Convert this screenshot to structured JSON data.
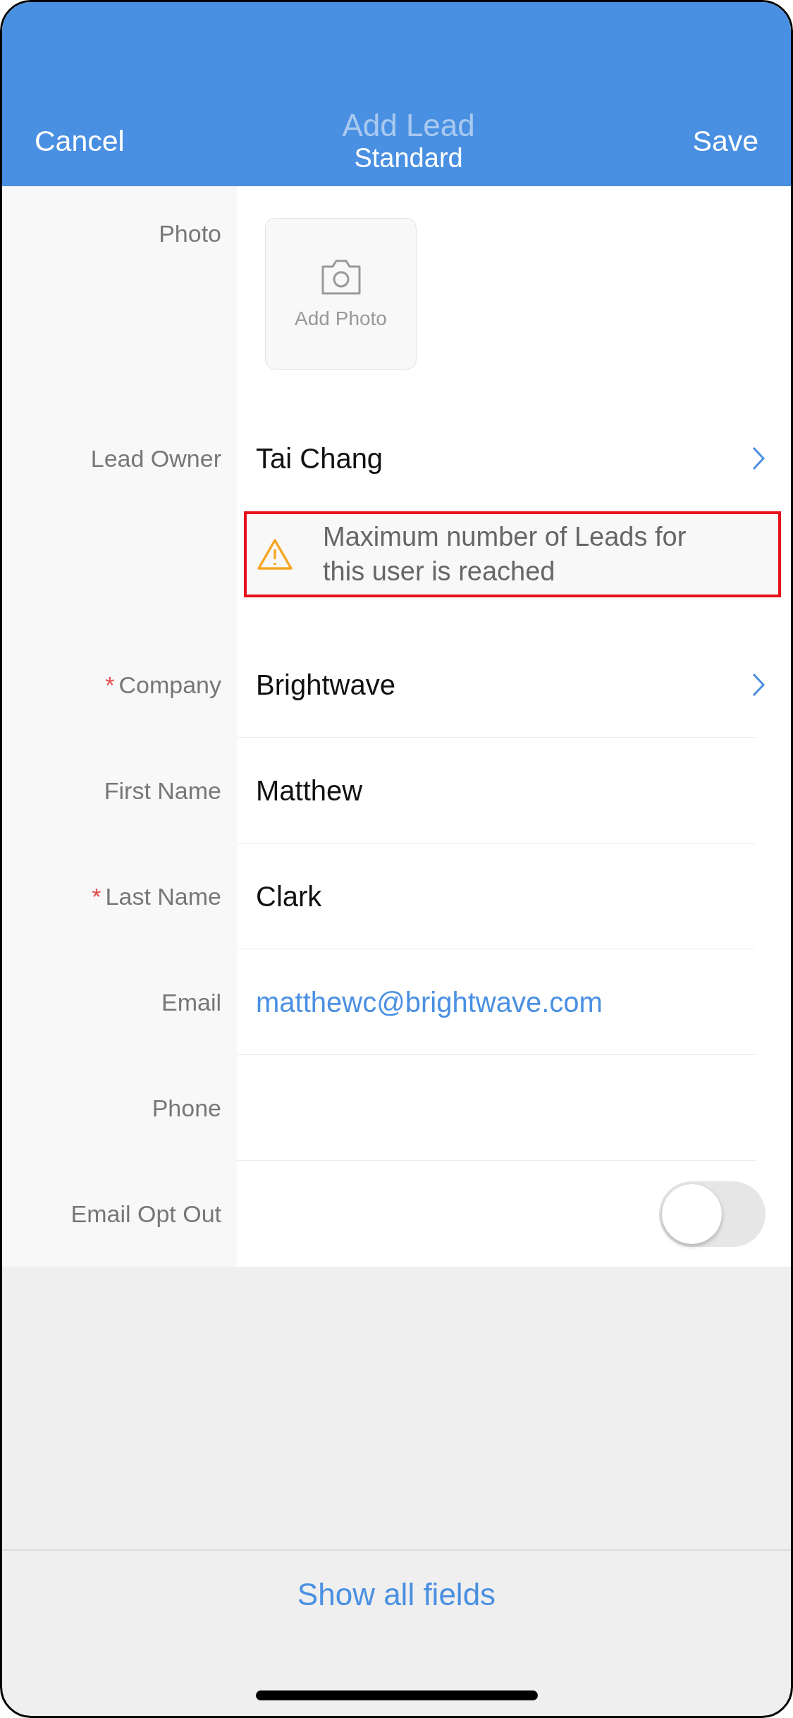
{
  "header": {
    "cancel": "Cancel",
    "title": "Add Lead",
    "subtitle": "Standard",
    "save": "Save"
  },
  "fields": [
    {
      "kind": "photo",
      "label": "Photo",
      "placeholder": "Add Photo"
    },
    {
      "kind": "lookup",
      "label": "Lead Owner",
      "value": "Tai Chang",
      "warning": "Maximum number of Leads for this user is reached"
    },
    {
      "kind": "lookup",
      "label": "Company",
      "required_mark": "*",
      "value": "Brightwave"
    },
    {
      "kind": "text",
      "label": "First Name",
      "value": "Matthew"
    },
    {
      "kind": "text",
      "label": "Last Name",
      "required_mark": "*",
      "value": "Clark"
    },
    {
      "kind": "email",
      "label": "Email",
      "value": "matthewc@brightwave.com"
    },
    {
      "kind": "text",
      "label": "Phone"
    },
    {
      "kind": "toggle",
      "label": "Email Opt Out",
      "on": false
    }
  ],
  "footer": {
    "link": "Show all fields"
  }
}
